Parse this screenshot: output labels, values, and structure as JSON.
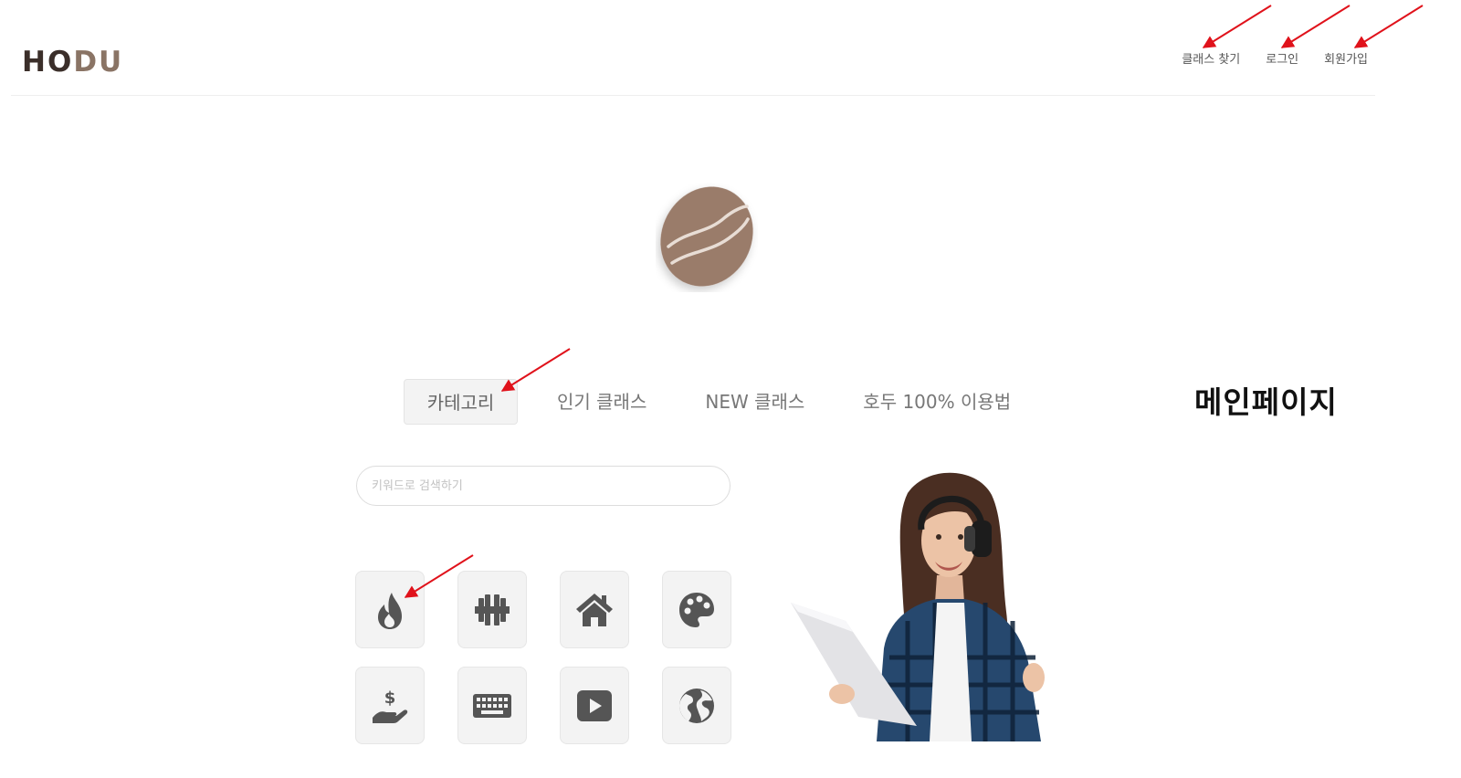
{
  "header": {
    "logo_text_pre": "HO",
    "logo_text_accent": "DU",
    "nav": [
      {
        "label": "클래스 찾기"
      },
      {
        "label": "로그인"
      },
      {
        "label": "회원가입"
      }
    ]
  },
  "main": {
    "tabs": [
      {
        "label": "카테고리",
        "active": true
      },
      {
        "label": "인기 클래스",
        "active": false
      },
      {
        "label": "NEW 클래스",
        "active": false
      },
      {
        "label": "호두 100% 이용법",
        "active": false
      }
    ],
    "search": {
      "placeholder": "키워드로 검색하기",
      "value": ""
    },
    "categories": [
      {
        "icon": "fire-icon"
      },
      {
        "icon": "dumbbell-icon"
      },
      {
        "icon": "house-icon"
      },
      {
        "icon": "palette-icon"
      },
      {
        "icon": "hand-dollar-icon"
      },
      {
        "icon": "keyboard-icon"
      },
      {
        "icon": "youtube-play-icon"
      },
      {
        "icon": "globe-icon"
      }
    ]
  },
  "annotation": {
    "page_label": "메인페이지",
    "arrow_color": "#e0121b"
  },
  "colors": {
    "brand_dark": "#3b2f2a",
    "brand_brown": "#9a7b6a",
    "icon_gray": "#555555"
  }
}
